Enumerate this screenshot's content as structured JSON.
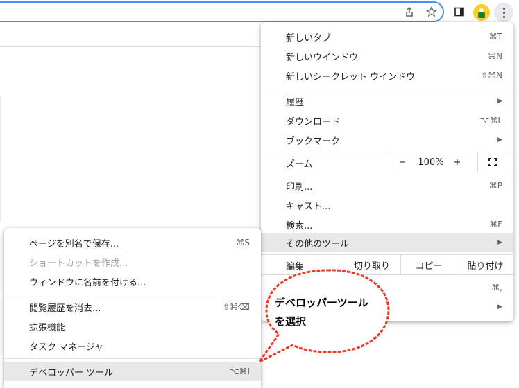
{
  "toolbar": {
    "icons": [
      "share-icon",
      "star-icon",
      "side-panel-icon",
      "profile-avatar",
      "more-menu-icon"
    ]
  },
  "main_menu": {
    "items": [
      {
        "label": "新しいタブ",
        "shortcut": "⌘T"
      },
      {
        "label": "新しいウインドウ",
        "shortcut": "⌘N"
      },
      {
        "label": "新しいシークレット ウインドウ",
        "shortcut": "⇧⌘N"
      },
      {
        "label": "履歴",
        "shortcut": ""
      },
      {
        "label": "ダウンロード",
        "shortcut": "⌥⌘L"
      },
      {
        "label": "ブックマーク",
        "shortcut": ""
      },
      {
        "label": "印刷...",
        "shortcut": "⌘P"
      },
      {
        "label": "キャスト...",
        "shortcut": ""
      },
      {
        "label": "検索...",
        "shortcut": "⌘F"
      },
      {
        "label": "その他のツール",
        "shortcut": ""
      }
    ],
    "zoom": {
      "label": "ズーム",
      "minus": "−",
      "value": "100%",
      "plus": "+"
    },
    "edit": {
      "label": "編集",
      "cut": "切り取り",
      "copy": "コピー",
      "paste": "貼り付け"
    },
    "settings_shortcut": "⌘,"
  },
  "sub_menu": {
    "items": [
      {
        "label": "ページを別名で保存...",
        "shortcut": "⌘S"
      },
      {
        "label": "ショートカットを作成...",
        "shortcut": ""
      },
      {
        "label": "ウィンドウに名前を付ける...",
        "shortcut": ""
      },
      {
        "label": "閲覧履歴を消去...",
        "shortcut": "⇧⌘⌫"
      },
      {
        "label": "拡張機能",
        "shortcut": ""
      },
      {
        "label": "タスク マネージャ",
        "shortcut": ""
      },
      {
        "label": "デベロッパー ツール",
        "shortcut": "⌥⌘I"
      }
    ]
  },
  "callout": {
    "line1": "デベロッパーツール",
    "line2": "を選択",
    "color": "#e83a2a"
  }
}
